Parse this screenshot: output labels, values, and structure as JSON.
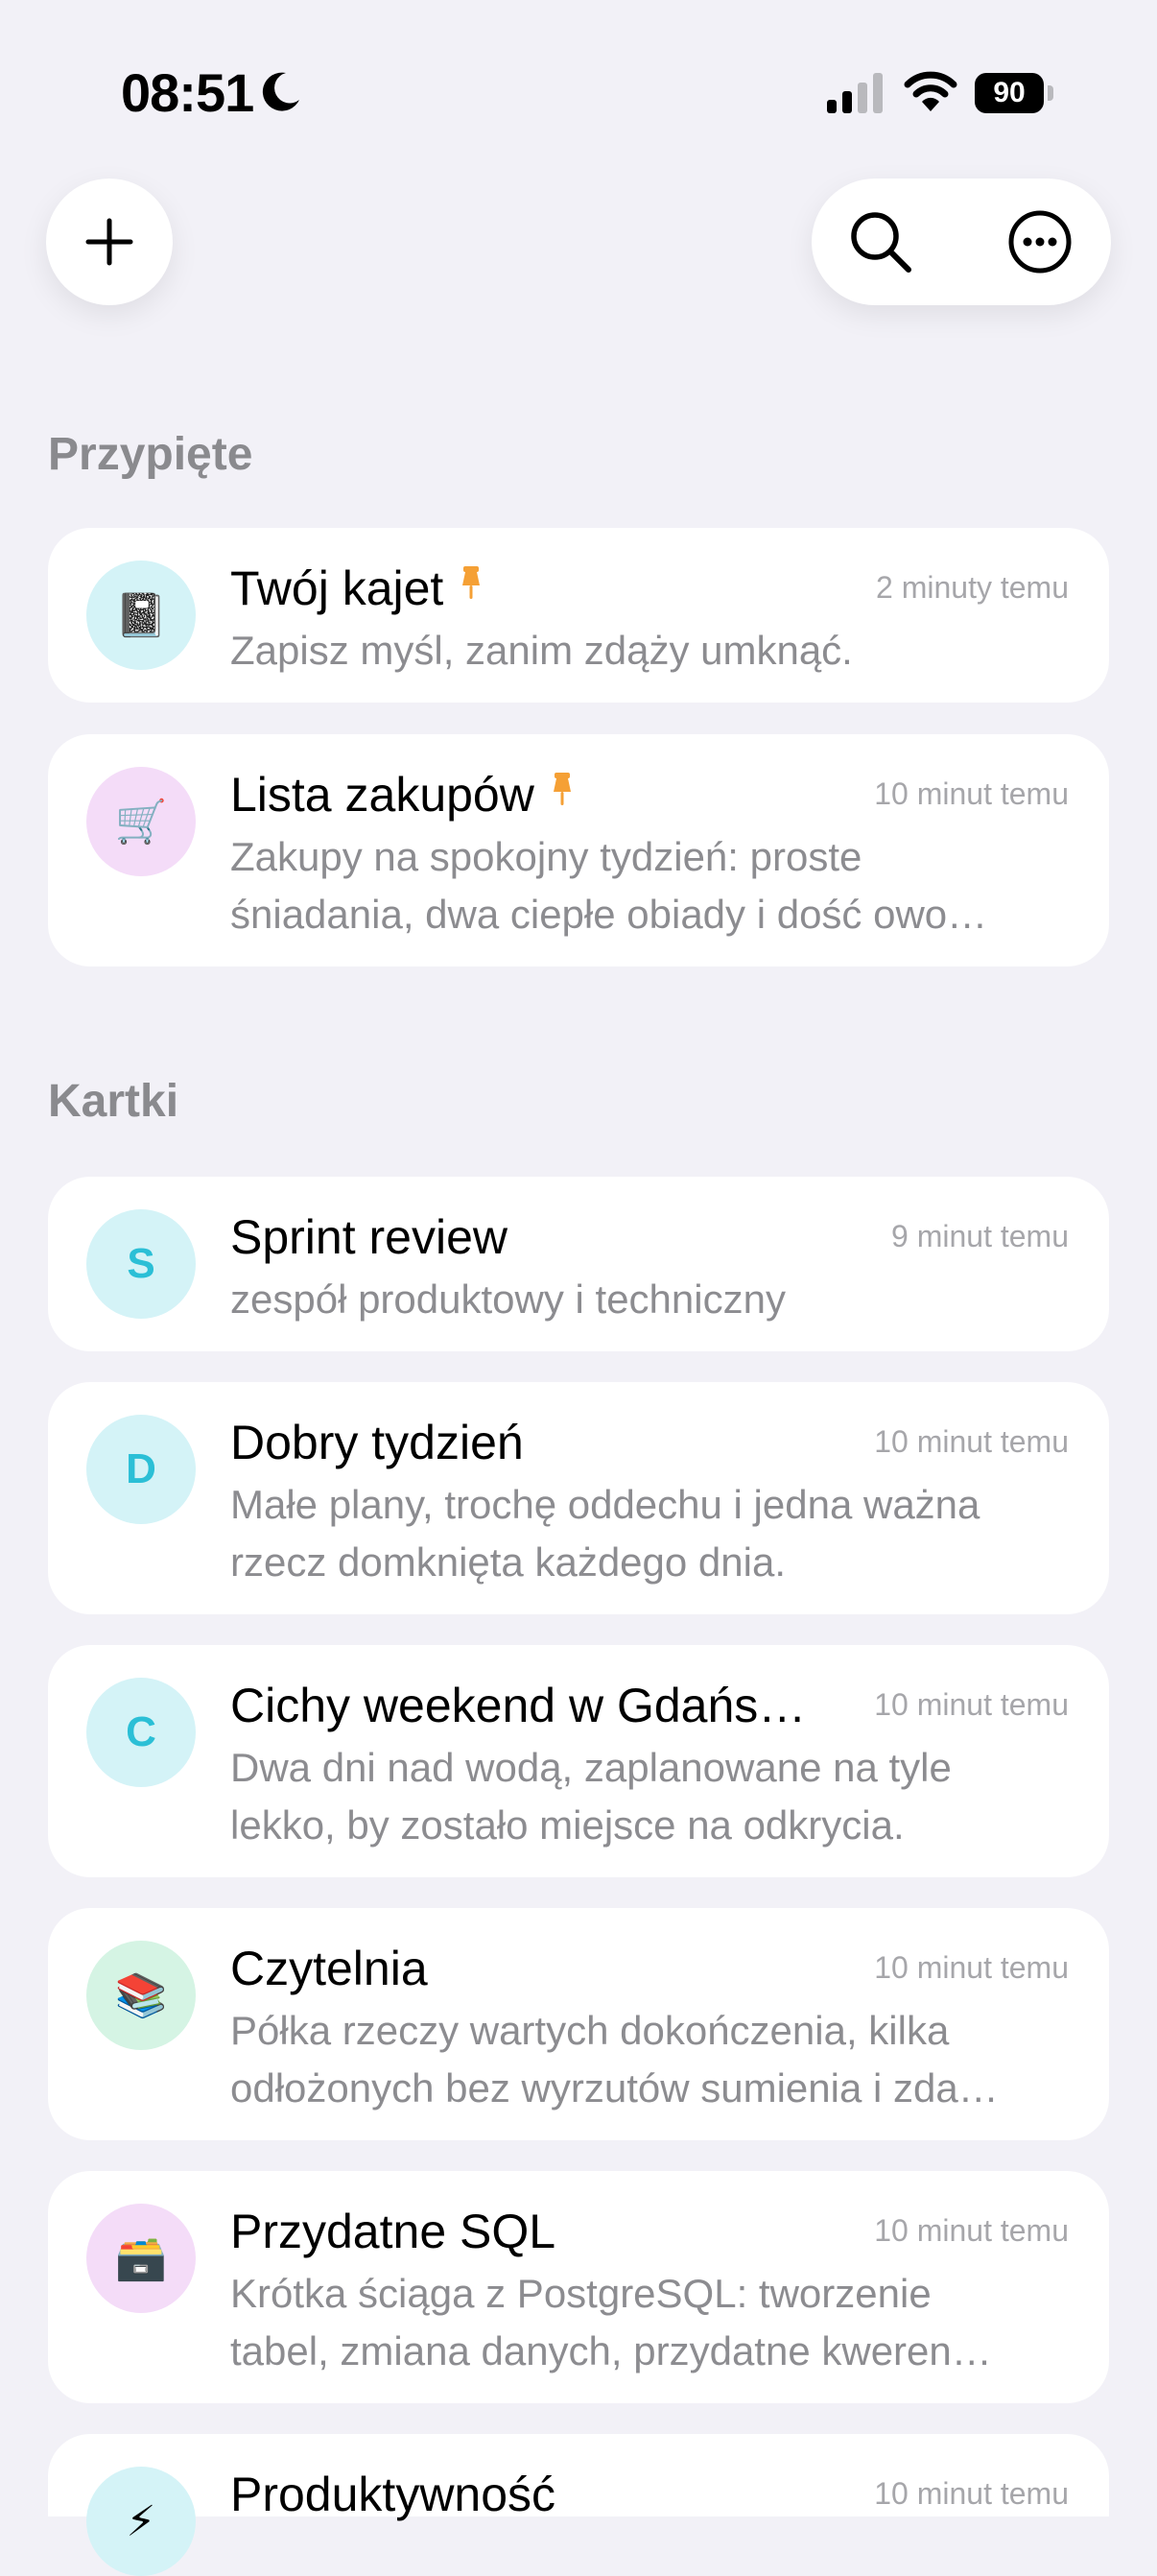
{
  "status_bar": {
    "time": "08:51",
    "battery": "90"
  },
  "colors": {
    "background": "#f2f1f7",
    "card": "#ffffff",
    "pin": "#f5a035",
    "avatar_cyan_bg": "#d4f3f7",
    "avatar_cyan_text": "#2bbfd6",
    "avatar_purple_bg": "#f4dcf8",
    "avatar_green_bg": "#d5f4e4"
  },
  "toolbar": {
    "add_icon": "plus-icon",
    "search_icon": "search-icon",
    "more_icon": "ellipsis-circle-icon"
  },
  "sections": {
    "pinned_title": "Przypięte",
    "notes_title": "Kartki"
  },
  "pinned": [
    {
      "icon": "📓",
      "title": "Twój kajet",
      "time": "2 minuty temu",
      "preview": "Zapisz myśl, zanim zdąży umknąć.",
      "pinned": true
    },
    {
      "icon": "🛒",
      "title": "Lista zakupów",
      "time": "10 minut temu",
      "preview_line1": "Zakupy na spokojny tydzień: proste",
      "preview_line2": "śniadania, dwa ciepłe obiady i dość owo…",
      "pinned": true
    }
  ],
  "notes": [
    {
      "letter": "S",
      "title": "Sprint review",
      "time": "9 minut temu",
      "preview": "zespół produktowy i techniczny"
    },
    {
      "letter": "D",
      "title": "Dobry tydzień",
      "time": "10 minut temu",
      "preview_line1": "Małe plany, trochę oddechu i jedna ważna",
      "preview_line2": "rzecz domknięta każdego dnia."
    },
    {
      "letter": "C",
      "title": "Cichy weekend w Gdańs…",
      "time": "10 minut temu",
      "preview_line1": "Dwa dni nad wodą, zaplanowane na tyle",
      "preview_line2": "lekko, by zostało miejsce na odkrycia."
    },
    {
      "icon": "📚",
      "title": "Czytelnia",
      "time": "10 minut temu",
      "preview_line1": "Półka rzeczy wartych dokończenia, kilka",
      "preview_line2": "odłożonych bez wyrzutów sumienia i zda…"
    },
    {
      "icon": "🗃️",
      "title": "Przydatne SQL",
      "time": "10 minut temu",
      "preview_line1": "Krótka ściąga z PostgreSQL: tworzenie",
      "preview_line2": "tabel, zmiana danych, przydatne kweren…"
    },
    {
      "icon": "⚡",
      "title": "Produktywność",
      "time": "10 minut temu"
    }
  ]
}
